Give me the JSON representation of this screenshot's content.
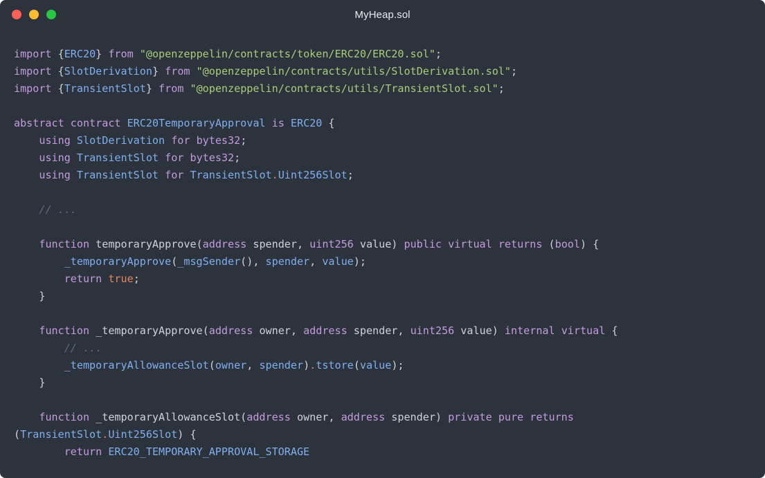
{
  "window": {
    "title": "MyHeap.sol",
    "background": "#2c333c",
    "traffic_lights": {
      "close_color": "#ff5f57",
      "minimize_color": "#febc2e",
      "zoom_color": "#28c840"
    }
  },
  "syntax_colors": {
    "keyword": "#c59be0",
    "type": "#7fb0ef",
    "string": "#a9cd7a",
    "literal": "#e8875a",
    "operator": "#e17a7a",
    "comment": "#5f6b79",
    "text": "#cfd3d9"
  },
  "code": {
    "lines": [
      [
        [
          "kw",
          "import"
        ],
        [
          "tx",
          " {"
        ],
        [
          "ty",
          "ERC20"
        ],
        [
          "tx",
          "} "
        ],
        [
          "kw",
          "from"
        ],
        [
          "tx",
          " "
        ],
        [
          "str",
          "\"@openzeppelin/contracts/token/ERC20/ERC20.sol\""
        ],
        [
          "tx",
          ";"
        ]
      ],
      [
        [
          "kw",
          "import"
        ],
        [
          "tx",
          " {"
        ],
        [
          "ty",
          "SlotDerivation"
        ],
        [
          "tx",
          "} "
        ],
        [
          "kw",
          "from"
        ],
        [
          "tx",
          " "
        ],
        [
          "str",
          "\"@openzeppelin/contracts/utils/SlotDerivation.sol\""
        ],
        [
          "tx",
          ";"
        ]
      ],
      [
        [
          "kw",
          "import"
        ],
        [
          "tx",
          " {"
        ],
        [
          "ty",
          "TransientSlot"
        ],
        [
          "tx",
          "} "
        ],
        [
          "kw",
          "from"
        ],
        [
          "tx",
          " "
        ],
        [
          "str",
          "\"@openzeppelin/contracts/utils/TransientSlot.sol\""
        ],
        [
          "tx",
          ";"
        ]
      ],
      [],
      [
        [
          "kw",
          "abstract"
        ],
        [
          "tx",
          " "
        ],
        [
          "kw",
          "contract"
        ],
        [
          "tx",
          " "
        ],
        [
          "ty",
          "ERC20TemporaryApproval"
        ],
        [
          "tx",
          " "
        ],
        [
          "kw",
          "is"
        ],
        [
          "tx",
          " "
        ],
        [
          "ty",
          "ERC20"
        ],
        [
          "tx",
          " {"
        ]
      ],
      [
        [
          "tx",
          "    "
        ],
        [
          "kw",
          "using"
        ],
        [
          "tx",
          " "
        ],
        [
          "ty",
          "SlotDerivation"
        ],
        [
          "tx",
          " "
        ],
        [
          "kw",
          "for"
        ],
        [
          "tx",
          " "
        ],
        [
          "kw",
          "bytes32"
        ],
        [
          "tx",
          ";"
        ]
      ],
      [
        [
          "tx",
          "    "
        ],
        [
          "kw",
          "using"
        ],
        [
          "tx",
          " "
        ],
        [
          "ty",
          "TransientSlot"
        ],
        [
          "tx",
          " "
        ],
        [
          "kw",
          "for"
        ],
        [
          "tx",
          " "
        ],
        [
          "kw",
          "bytes32"
        ],
        [
          "tx",
          ";"
        ]
      ],
      [
        [
          "tx",
          "    "
        ],
        [
          "kw",
          "using"
        ],
        [
          "tx",
          " "
        ],
        [
          "ty",
          "TransientSlot"
        ],
        [
          "tx",
          " "
        ],
        [
          "kw",
          "for"
        ],
        [
          "tx",
          " "
        ],
        [
          "ty",
          "TransientSlot"
        ],
        [
          "op",
          "."
        ],
        [
          "ty",
          "Uint256Slot"
        ],
        [
          "tx",
          ";"
        ]
      ],
      [],
      [
        [
          "tx",
          "    "
        ],
        [
          "cm",
          "// ..."
        ]
      ],
      [],
      [
        [
          "tx",
          "    "
        ],
        [
          "kw",
          "function"
        ],
        [
          "tx",
          " temporaryApprove("
        ],
        [
          "kw",
          "address"
        ],
        [
          "tx",
          " spender, "
        ],
        [
          "kw",
          "uint256"
        ],
        [
          "tx",
          " value) "
        ],
        [
          "kw",
          "public"
        ],
        [
          "tx",
          " "
        ],
        [
          "kw",
          "virtual"
        ],
        [
          "tx",
          " "
        ],
        [
          "kw",
          "returns"
        ],
        [
          "tx",
          " ("
        ],
        [
          "kw",
          "bool"
        ],
        [
          "tx",
          ") {"
        ]
      ],
      [
        [
          "tx",
          "        "
        ],
        [
          "fn",
          "_temporaryApprove"
        ],
        [
          "tx",
          "("
        ],
        [
          "fn",
          "_msgSender"
        ],
        [
          "tx",
          "(), "
        ],
        [
          "fn",
          "spender"
        ],
        [
          "tx",
          ", "
        ],
        [
          "fn",
          "value"
        ],
        [
          "tx",
          ");"
        ]
      ],
      [
        [
          "tx",
          "        "
        ],
        [
          "kw",
          "return"
        ],
        [
          "tx",
          " "
        ],
        [
          "num",
          "true"
        ],
        [
          "tx",
          ";"
        ]
      ],
      [
        [
          "tx",
          "    }"
        ]
      ],
      [],
      [
        [
          "tx",
          "    "
        ],
        [
          "kw",
          "function"
        ],
        [
          "tx",
          " _temporaryApprove("
        ],
        [
          "kw",
          "address"
        ],
        [
          "tx",
          " owner, "
        ],
        [
          "kw",
          "address"
        ],
        [
          "tx",
          " spender, "
        ],
        [
          "kw",
          "uint256"
        ],
        [
          "tx",
          " value) "
        ],
        [
          "kw",
          "internal"
        ],
        [
          "tx",
          " "
        ],
        [
          "kw",
          "virtual"
        ],
        [
          "tx",
          " {"
        ]
      ],
      [
        [
          "tx",
          "        "
        ],
        [
          "cm",
          "// ..."
        ]
      ],
      [
        [
          "tx",
          "        "
        ],
        [
          "fn",
          "_temporaryAllowanceSlot"
        ],
        [
          "tx",
          "("
        ],
        [
          "fn",
          "owner"
        ],
        [
          "tx",
          ", "
        ],
        [
          "fn",
          "spender"
        ],
        [
          "tx",
          ")"
        ],
        [
          "op",
          "."
        ],
        [
          "fn",
          "tstore"
        ],
        [
          "tx",
          "("
        ],
        [
          "fn",
          "value"
        ],
        [
          "tx",
          ");"
        ]
      ],
      [
        [
          "tx",
          "    }"
        ]
      ],
      [],
      [
        [
          "tx",
          "    "
        ],
        [
          "kw",
          "function"
        ],
        [
          "tx",
          " _temporaryAllowanceSlot("
        ],
        [
          "kw",
          "address"
        ],
        [
          "tx",
          " owner, "
        ],
        [
          "kw",
          "address"
        ],
        [
          "tx",
          " spender) "
        ],
        [
          "kw",
          "private"
        ],
        [
          "tx",
          " "
        ],
        [
          "kw",
          "pure"
        ],
        [
          "tx",
          " "
        ],
        [
          "kw",
          "returns"
        ]
      ],
      [
        [
          "tx",
          "("
        ],
        [
          "ty",
          "TransientSlot"
        ],
        [
          "op",
          "."
        ],
        [
          "ty",
          "Uint256Slot"
        ],
        [
          "tx",
          ") {"
        ]
      ],
      [
        [
          "tx",
          "        "
        ],
        [
          "kw",
          "return"
        ],
        [
          "tx",
          " "
        ],
        [
          "ty",
          "ERC20_TEMPORARY_APPROVAL_STORAGE"
        ]
      ]
    ]
  }
}
